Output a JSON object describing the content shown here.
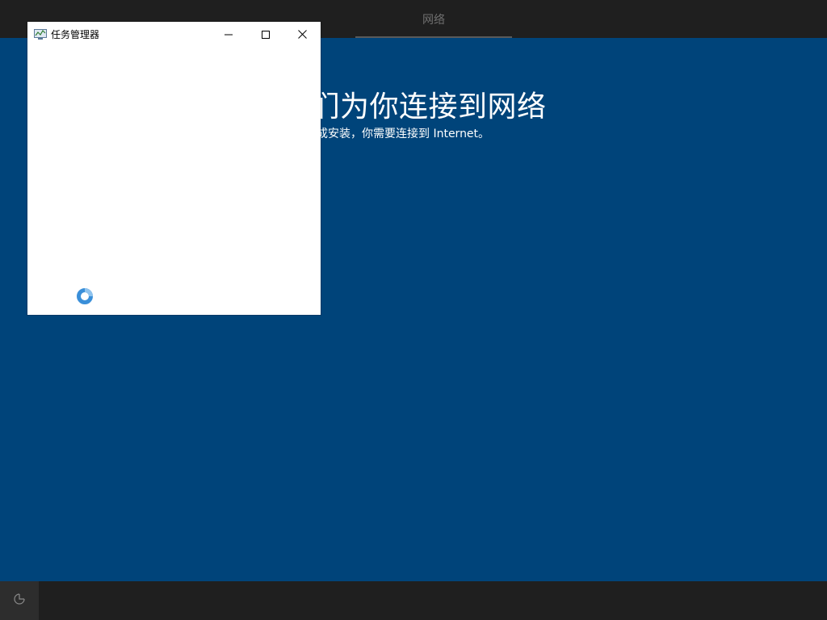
{
  "header": {
    "tab_label": "网络"
  },
  "main": {
    "title": "我们为你连接到网络",
    "subtitle": "需要完成安装，你需要连接到 Internet。"
  },
  "task_manager": {
    "title": "任务管理器",
    "icon": "task-manager-icon",
    "controls": {
      "minimize": "minimize-icon",
      "maximize": "maximize-icon",
      "close": "close-icon"
    },
    "loading_indicator": "loading-spinner-icon"
  },
  "footer": {
    "accessibility_icon": "accessibility-icon"
  },
  "colors": {
    "background": "#00447a",
    "bar": "#1f1f1f",
    "tab_text": "#6f6f6f",
    "spinner": "#3a8fd9"
  }
}
